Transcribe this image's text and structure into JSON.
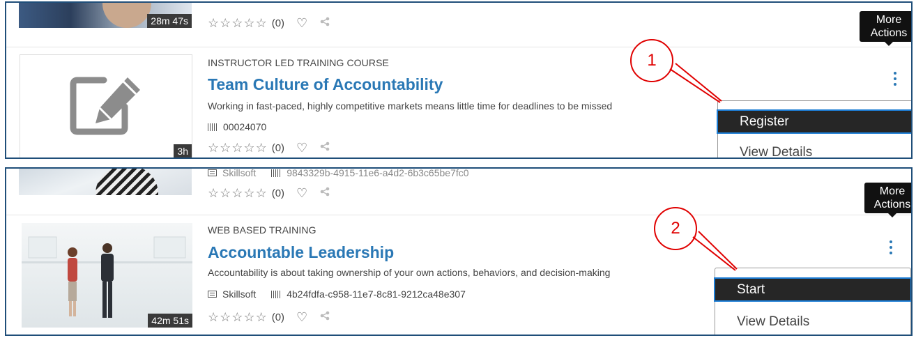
{
  "top_panel": {
    "prev_card": {
      "duration": "28m 47s",
      "rating_count": "(0)"
    },
    "card": {
      "type": "INSTRUCTOR LED TRAINING COURSE",
      "title": "Team Culture of Accountability",
      "description": "Working in fast-paced, highly competitive markets means little time for deadlines to be missed",
      "code": "00024070",
      "duration": "3h",
      "rating_count": "(0)",
      "thumbnail_icon": "edit-icon"
    },
    "tooltip": "More Actions",
    "menu": {
      "primary": "Register",
      "secondary": "View Details"
    },
    "callout": "1"
  },
  "bottom_panel": {
    "prev_card": {
      "provider": "Skillsoft",
      "code": "9843329b-4915-11e6-a4d2-6b3c65be7fc0",
      "rating_count": "(0)"
    },
    "card": {
      "type": "WEB BASED TRAINING",
      "title": "Accountable Leadership",
      "description": "Accountability is about taking ownership of your own actions, behaviors, and decision-making",
      "provider": "Skillsoft",
      "code": "4b24fdfa-c958-11e7-8c81-9212ca48e307",
      "duration": "42m 51s",
      "rating_count": "(0)"
    },
    "tooltip": "More Actions",
    "menu": {
      "primary": "Start",
      "secondary": "View Details"
    },
    "callout": "2"
  },
  "icons": {
    "rating": "star-outline-icon",
    "favorite": "heart-outline-icon",
    "share": "share-icon",
    "menu": "kebab-icon"
  },
  "colors": {
    "accent": "#2a78b5",
    "panel_border": "#1f4e79",
    "callout": "#e00000"
  }
}
